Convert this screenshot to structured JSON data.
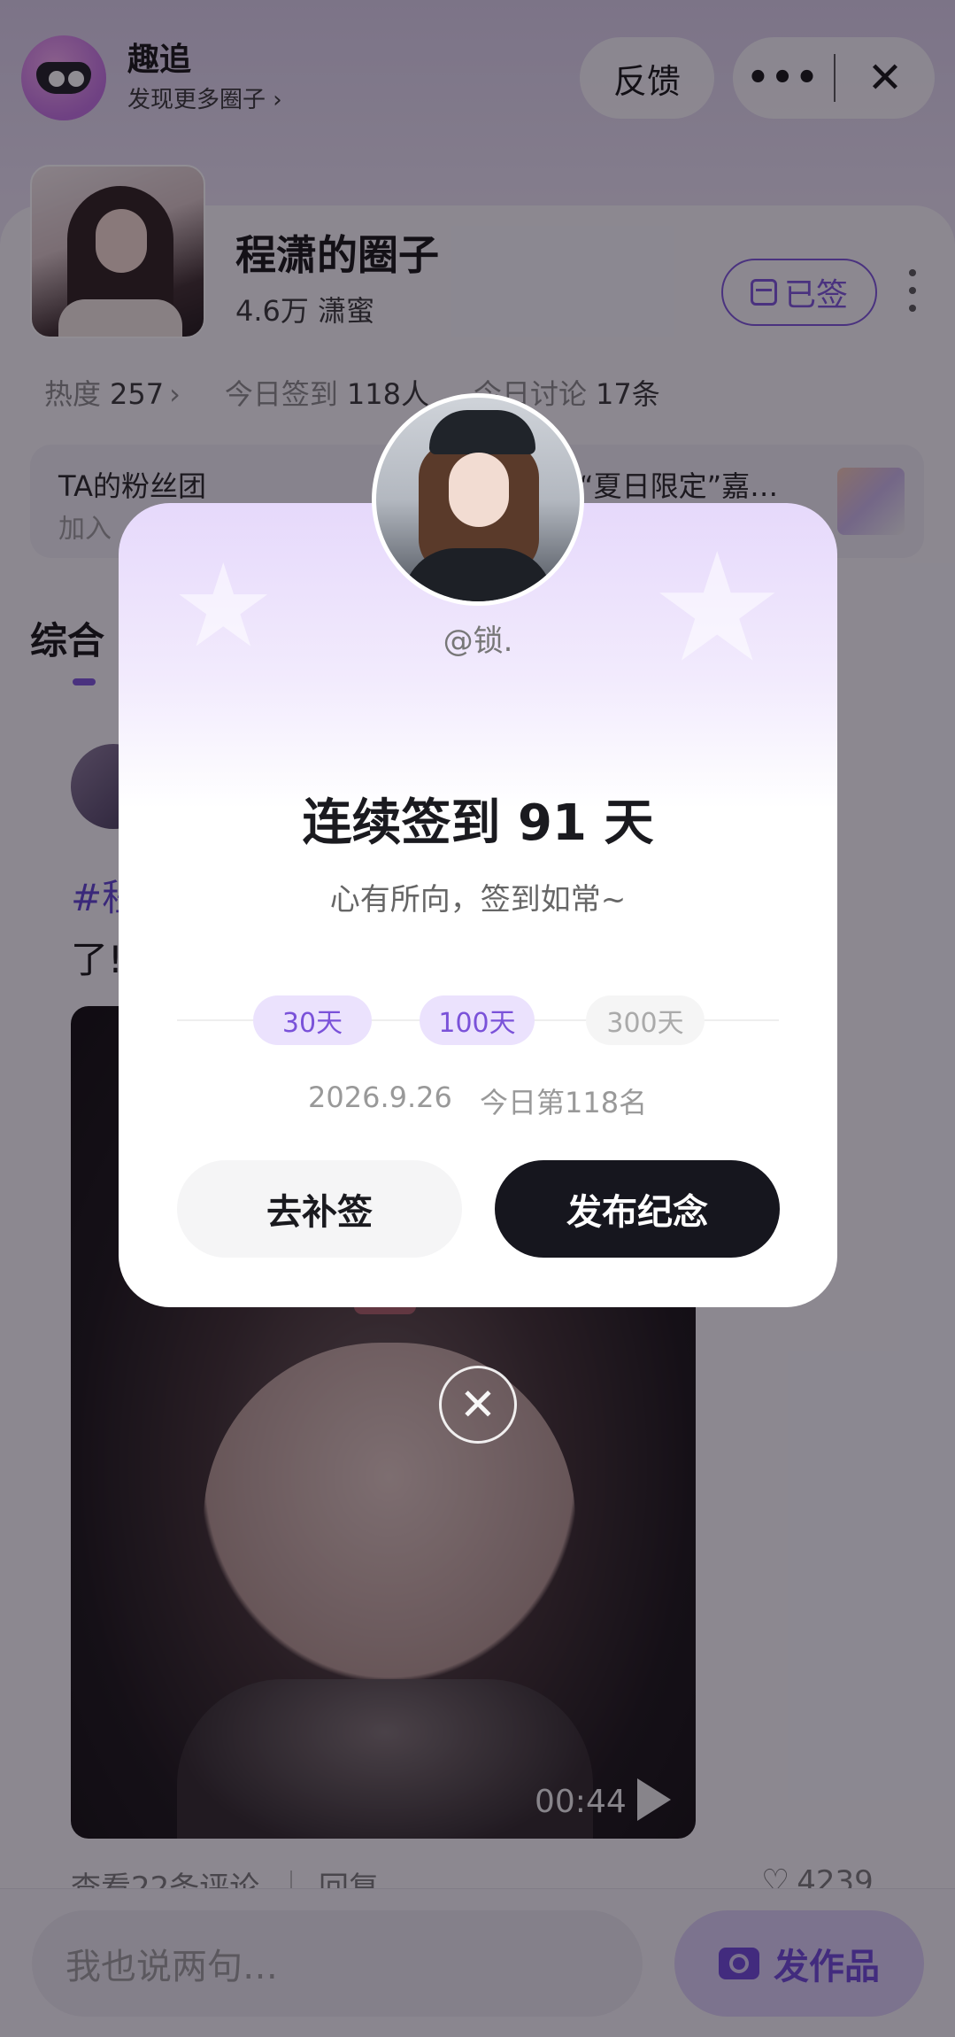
{
  "mini_app": {
    "name": "趣追",
    "subtitle": "发现更多圈子 ›",
    "feedback_label": "反馈",
    "more_label": "•••",
    "close_label": "✕"
  },
  "circle": {
    "title": "程潇的圈子",
    "fans": "4.6万 潇蜜",
    "signed_label": "已签",
    "stats": {
      "heat_label": "热度",
      "heat_value": "257",
      "checkin_label": "今日签到",
      "checkin_value": "118人",
      "discuss_label": "今日讨论",
      "discuss_value": "17条"
    },
    "fan_group": {
      "title": "TA的粉丝团",
      "subtitle": "加入"
    },
    "event_title": "“夏日限定”嘉…",
    "tab_active": "综合"
  },
  "post": {
    "tag": "#程",
    "text": "了!",
    "duration": "00:44",
    "comments_link": "查看22条评论",
    "reply_link": "回复",
    "likes": "4239"
  },
  "bottom_bar": {
    "comment_placeholder": "我也说两句…",
    "publish_label": "发作品"
  },
  "modal": {
    "handle": "@锁.",
    "title": "连续签到 91 天",
    "subtitle": "心有所向，签到如常~",
    "milestones": [
      "30天",
      "100天",
      "300天"
    ],
    "date": "2026.9.26",
    "rank": "今日第118名",
    "makeup_button": "去补签",
    "memorial_button": "发布纪念",
    "close_symbol": "✕"
  },
  "colors": {
    "accent": "#7a52d9",
    "primary_button": "#16161e",
    "overlay": "rgba(22,16,30,0.48)"
  }
}
